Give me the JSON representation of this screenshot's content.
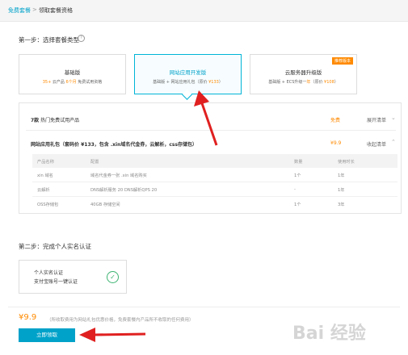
{
  "breadcrumb": {
    "link": "免费套餐",
    "separator": ">",
    "current": "领取套餐资格"
  },
  "step1": {
    "title": "第一步：选择套餐类型",
    "cards": [
      {
        "title": "基础版",
        "desc_pre": "",
        "desc_orange1": "35+",
        "desc_mid": " 云产品 ",
        "desc_orange2": "6个月",
        "desc_post": " 免费试用资格"
      },
      {
        "title": "网站应用开发版",
        "desc_pre": "基础版 + 网站应用礼包（原价 ",
        "desc_orange1": "¥133",
        "desc_mid": "）",
        "desc_orange2": "",
        "desc_post": ""
      },
      {
        "title": "云服务器升级版",
        "badge": "推荐版本",
        "desc_pre": "基础版 + ECS升级一",
        "desc_orange1": "年",
        "desc_mid": "（原价 ",
        "desc_orange2": "¥108",
        "desc_post": "）"
      }
    ]
  },
  "detail": {
    "row1": {
      "title_bold": "7款",
      "title_rest": " 热门免费试用产品",
      "price": "免费",
      "link": "展开清单",
      "chevron": "⌄"
    },
    "row2": {
      "title": "网站应用礼包（套码价 ¥133，包含 .xin域名代金券，云解析，css存储包）",
      "price": "¥9.9",
      "link": "收起清单",
      "chevron": "⌃"
    },
    "table": {
      "headers": [
        "产品名称",
        "配置",
        "数量",
        "使用时长"
      ],
      "rows": [
        [
          "xin 域名",
          "域名代金券一张 .xin 域名购买",
          "1个",
          "1年"
        ],
        [
          "云解析",
          "DNS解析服务 20 DNS解析QPS 20",
          "-",
          "1年"
        ],
        [
          "OSS存储包",
          "40GB 存储空间",
          "1个",
          "3年"
        ]
      ]
    }
  },
  "step2": {
    "title": "第二步：完成个人实名认证",
    "card_title": "个人实名认证",
    "card_sub": "支付宝账号一键认证"
  },
  "footer": {
    "price": "¥9.9",
    "note": "（所收取费用为网站礼包优惠价格，免费套餐内产品所不收取的任何费用）",
    "button": "立即领取"
  },
  "watermark": "Bai 经验",
  "colors": {
    "accent": "#00a2ca",
    "price": "#ff8a00",
    "arrow": "#e02020"
  }
}
